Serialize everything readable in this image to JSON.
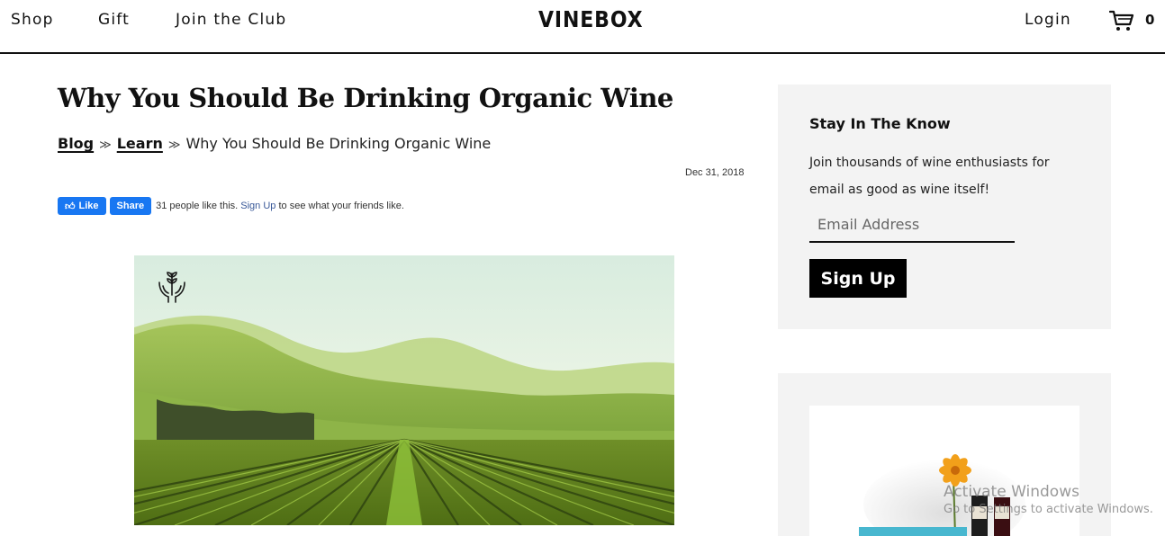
{
  "header": {
    "nav": [
      "Shop",
      "Gift",
      "Join the Club"
    ],
    "logo": "VINEBOX",
    "login": "Login",
    "cart_count": "0"
  },
  "article": {
    "title": "Why You Should Be Drinking Organic Wine",
    "breadcrumb": {
      "blog": "Blog",
      "learn": "Learn",
      "sep": "≫",
      "current": "Why You Should Be Drinking Organic Wine"
    },
    "date": "Dec 31, 2018",
    "social": {
      "like_label": "Like",
      "share_label": "Share",
      "count_text": "31 people like this.",
      "signup_link": "Sign Up",
      "suffix": "to see what your friends like."
    },
    "hero_icon": "hands-sprout-icon"
  },
  "sidebar": {
    "newsletter": {
      "heading": "Stay In The Know",
      "text": "Join thousands of wine enthusiasts for email as good as wine itself!",
      "placeholder": "Email Address",
      "button": "Sign Up"
    }
  },
  "os_overlay": {
    "title": "Activate Windows",
    "subtitle": "Go to Settings to activate Windows."
  },
  "colors": {
    "facebook": "#1877f2",
    "sidebar_bg": "#f3f3f3",
    "button_bg": "#000000"
  }
}
